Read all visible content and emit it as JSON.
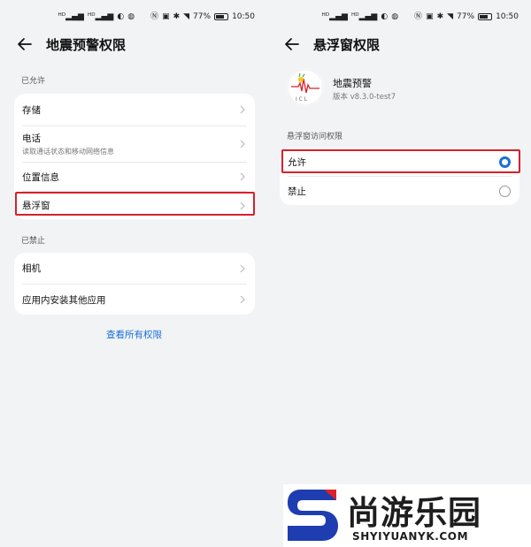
{
  "status_bar": {
    "battery": "77%",
    "time": "10:50"
  },
  "left": {
    "title": "地震预警权限",
    "allowed_header": "已允许",
    "allowed_items": [
      {
        "title": "存储",
        "subtitle": ""
      },
      {
        "title": "电话",
        "subtitle": "读取通话状态和移动网络信息"
      },
      {
        "title": "位置信息",
        "subtitle": ""
      },
      {
        "title": "悬浮窗",
        "subtitle": ""
      }
    ],
    "denied_header": "已禁止",
    "denied_items": [
      {
        "title": "相机"
      },
      {
        "title": "应用内安装其他应用"
      }
    ],
    "view_all": "查看所有权限"
  },
  "right": {
    "title": "悬浮窗权限",
    "app_name": "地震预警",
    "app_version": "版本 v8.3.0-test7",
    "app_icon_letters": "I C L",
    "section_header": "悬浮窗访问权限",
    "options": [
      {
        "label": "允许",
        "selected": true
      },
      {
        "label": "禁止",
        "selected": false
      }
    ]
  },
  "watermark": {
    "text": "尚游乐园",
    "url": "SHYIYUANYK.COM"
  },
  "colors": {
    "accent": "#1a6fd8",
    "highlight": "#d8202a",
    "background": "#f1f3f5"
  }
}
